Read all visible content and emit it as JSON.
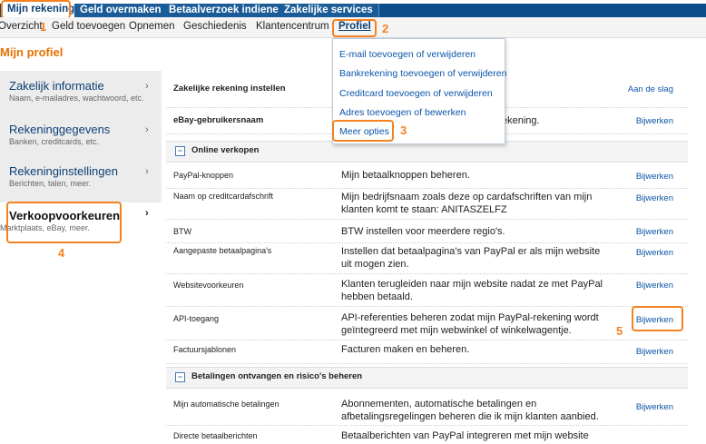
{
  "top_tabs": [
    "Mijn rekening",
    "Geld overmaken",
    "Betaalverzoek indienen",
    "Zakelijke services"
  ],
  "sub_nav": [
    "Overzicht",
    "Geld toevoegen",
    "Opnemen",
    "Geschiedenis",
    "Klantencentrum",
    "Profiel"
  ],
  "page_title": "Mijn profiel",
  "sidebar": [
    {
      "label": "Zakelijk informatie",
      "sub": "Naam, e-mailadres, wachtwoord, etc."
    },
    {
      "label": "Rekeninggegevens",
      "sub": "Banken, creditcards, etc."
    },
    {
      "label": "Rekeninginstellingen",
      "sub": "Berichten, talen, meer."
    },
    {
      "label": "Verkoopvoorkeuren",
      "sub": "Marktplaats, eBay, meer."
    }
  ],
  "dropdown": [
    "E-mail toevoegen of verwijderen",
    "Bankrekening toevoegen of verwijderen",
    "Creditcard toevoegen of verwijderen",
    "Adres toevoegen of bewerken",
    "Meer opties"
  ],
  "top_rows": [
    {
      "label": "Zakelijke rekening instellen",
      "action": "Aan de slag"
    },
    {
      "label": "eBay-gebruikersnaam",
      "desc_tail": "ekening.",
      "action": "Bijwerken"
    }
  ],
  "section1": "Online verkopen",
  "rows1": [
    {
      "label": "PayPal-knoppen",
      "desc": "Mijn betaalknoppen beheren.",
      "action": "Bijwerken"
    },
    {
      "label": "Naam op creditcardafschrift",
      "desc": "Mijn bedrijfsnaam zoals deze op cardafschriften van mijn klanten komt te staan: ANITASZELFZ",
      "action": "Bijwerken"
    },
    {
      "label": "BTW",
      "desc": "BTW instellen voor meerdere regio's.",
      "action": "Bijwerken"
    },
    {
      "label": "Aangepaste betaalpagina's",
      "desc": "Instellen dat betaalpagina's van PayPal er als mijn website uit mogen zien.",
      "action": "Bijwerken"
    },
    {
      "label": "Websitevoorkeuren",
      "desc": "Klanten terugleiden naar mijn website nadat ze met PayPal hebben betaald.",
      "action": "Bijwerken"
    },
    {
      "label": "API-toegang",
      "desc": "API-referenties beheren zodat mijn PayPal-rekening wordt geïntegreerd met mijn webwinkel of winkelwagentje.",
      "action": "Bijwerken"
    },
    {
      "label": "Factuursjablonen",
      "desc": "Facturen maken en beheren.",
      "action": "Bijwerken"
    }
  ],
  "section2": "Betalingen ontvangen en risico's beheren",
  "rows2": [
    {
      "label": "Mijn automatische betalingen",
      "desc": "Abonnementen, automatische betalingen en afbetalingsregelingen beheren die ik mijn klanten aanbied.",
      "action": "Bijwerken"
    },
    {
      "label": "Directe betaalberichten",
      "desc": "Betaalberichten van PayPal integreren met mijn website",
      "action": ""
    }
  ],
  "annotations": [
    "1",
    "2",
    "3",
    "4",
    "5"
  ],
  "colors": {
    "brand_blue": "#0b4e8a",
    "annotation_orange": "#f58220",
    "link_blue": "#0b55a8"
  }
}
